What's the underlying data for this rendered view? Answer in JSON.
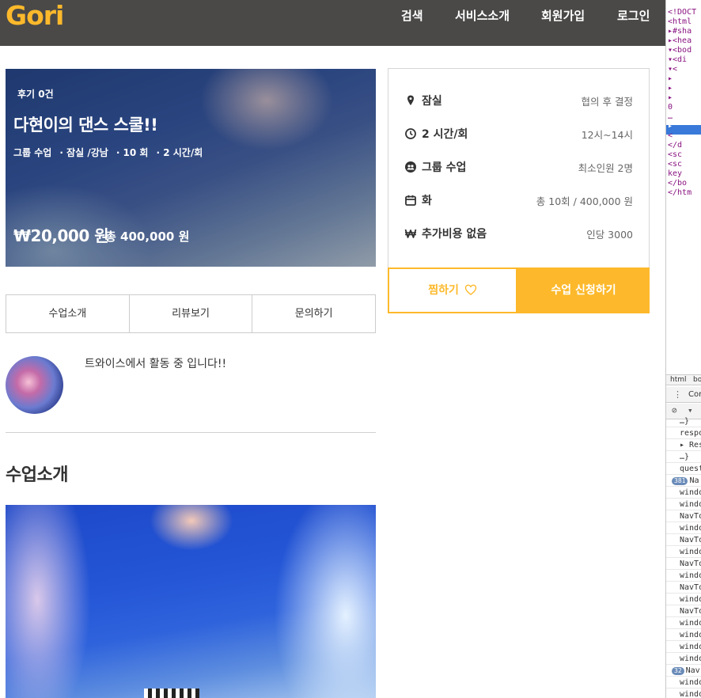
{
  "header": {
    "logo": "Gori",
    "nav": [
      "검색",
      "서비스소개",
      "회원가입",
      "로그인"
    ]
  },
  "hero": {
    "review": "후기 0건",
    "title": "다현이의 댄스 스쿨!!",
    "meta": [
      "그룹 수업",
      "· 잠실 /강남",
      "· 10 회",
      "· 2 시간/회"
    ],
    "price": "₩20,000 원",
    "total": "총 400,000 원"
  },
  "info": [
    {
      "icon": "location-pin-icon",
      "label": "잠실",
      "value": "협의 후 결정"
    },
    {
      "icon": "clock-icon",
      "label": "2 시간/회",
      "value": "12시~14시"
    },
    {
      "icon": "group-icon",
      "label": "그룹 수업",
      "value": "최소인원 2명"
    },
    {
      "icon": "calendar-icon",
      "label": "화",
      "value": "총 10회 / 400,000 원"
    },
    {
      "icon": "won-icon",
      "label": "추가비용 없음",
      "value": "인당 3000"
    }
  ],
  "actions": {
    "wish": "찜하기",
    "apply": "수업 신청하기"
  },
  "tabs": [
    "수업소개",
    "리뷰보기",
    "문의하기"
  ],
  "intro": "트와이스에서 활동 중 입니다!!",
  "section_title": "수업소개",
  "devtools": {
    "tree_lines": [
      "<!DOCT",
      "<html",
      "▸#sha",
      "▸<hea",
      "▾<bod",
      " ▾<di",
      "  ▾<",
      "   ▸",
      "   ▸",
      "   ▸",
      "   0",
      "   …",
      "   ▸",
      "   <",
      "  </d",
      "  <sc",
      "  <sc",
      "  key",
      " </bo",
      "</htm"
    ],
    "tabs": [
      "html",
      "bo"
    ],
    "toolbar_label": "Con",
    "console": [
      "…}",
      "respo",
      "▸ Res",
      "…}",
      "quest",
      "Na",
      "windo",
      "windo",
      "NavTo",
      "windo",
      "NavTo",
      "windo",
      "NavTo",
      "windo",
      "NavTo",
      "windo",
      "NavTo",
      "windo",
      "windo",
      "windo",
      "windo",
      "Nav",
      "windo",
      "windo",
      "windo"
    ],
    "badges": {
      "5": "381",
      "21": "32"
    }
  },
  "colors": {
    "accent": "#fdb92b",
    "topbar": "#4a4948"
  }
}
